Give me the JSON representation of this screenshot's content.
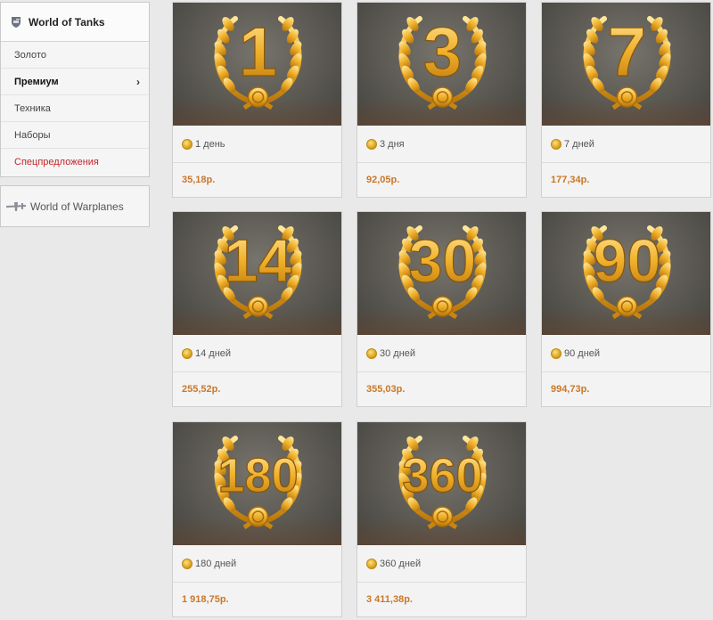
{
  "sidebar": {
    "wot_title": "World of Tanks",
    "menu": [
      {
        "label": "Золото"
      },
      {
        "label": "Премиум"
      },
      {
        "label": "Техника"
      },
      {
        "label": "Наборы"
      },
      {
        "label": "Спецпредложения"
      }
    ],
    "active_chevron": "›",
    "wowp_title": "World of Warplanes",
    "special_color": "#c0262b"
  },
  "cards": [
    {
      "number": "1",
      "name": "1 день",
      "price": "35,18р."
    },
    {
      "number": "3",
      "name": "3 дня",
      "price": "92,05р."
    },
    {
      "number": "7",
      "name": "7 дней",
      "price": "177,34р."
    },
    {
      "number": "14",
      "name": "14 дней",
      "price": "255,52р."
    },
    {
      "number": "30",
      "name": "30 дней",
      "price": "355,03р."
    },
    {
      "number": "90",
      "name": "90 дней",
      "price": "994,73р."
    },
    {
      "number": "180",
      "name": "180 дней",
      "price": "1 918,75р."
    },
    {
      "number": "360",
      "name": "360 дней",
      "price": "3 411,38р."
    }
  ],
  "colors": {
    "price": "#c9782a",
    "gold": "#e6a81c"
  }
}
